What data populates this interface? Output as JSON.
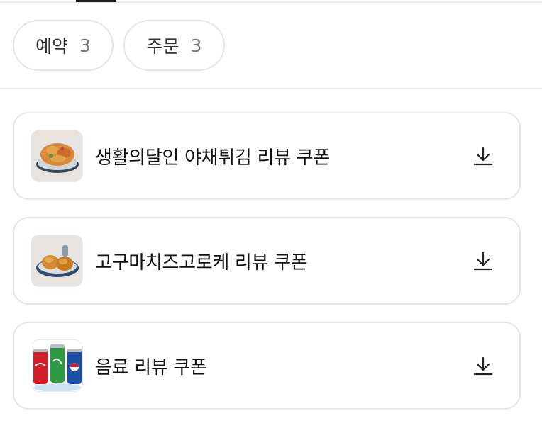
{
  "filters": [
    {
      "label": "예약",
      "count": "3"
    },
    {
      "label": "주문",
      "count": "3"
    }
  ],
  "coupons": [
    {
      "title": "생활의달인 야채튀김 리뷰 쿠폰",
      "image": "vegetable-tempura-plate"
    },
    {
      "title": "고구마치즈고로케 리뷰 쿠폰",
      "image": "sweet-potato-croquette-plate"
    },
    {
      "title": "음료 리뷰 쿠폰",
      "image": "soda-cans"
    }
  ],
  "icons": {
    "download": "download-icon"
  },
  "colors": {
    "border": "#e6e6e6",
    "text": "#111111",
    "count": "#777777"
  }
}
